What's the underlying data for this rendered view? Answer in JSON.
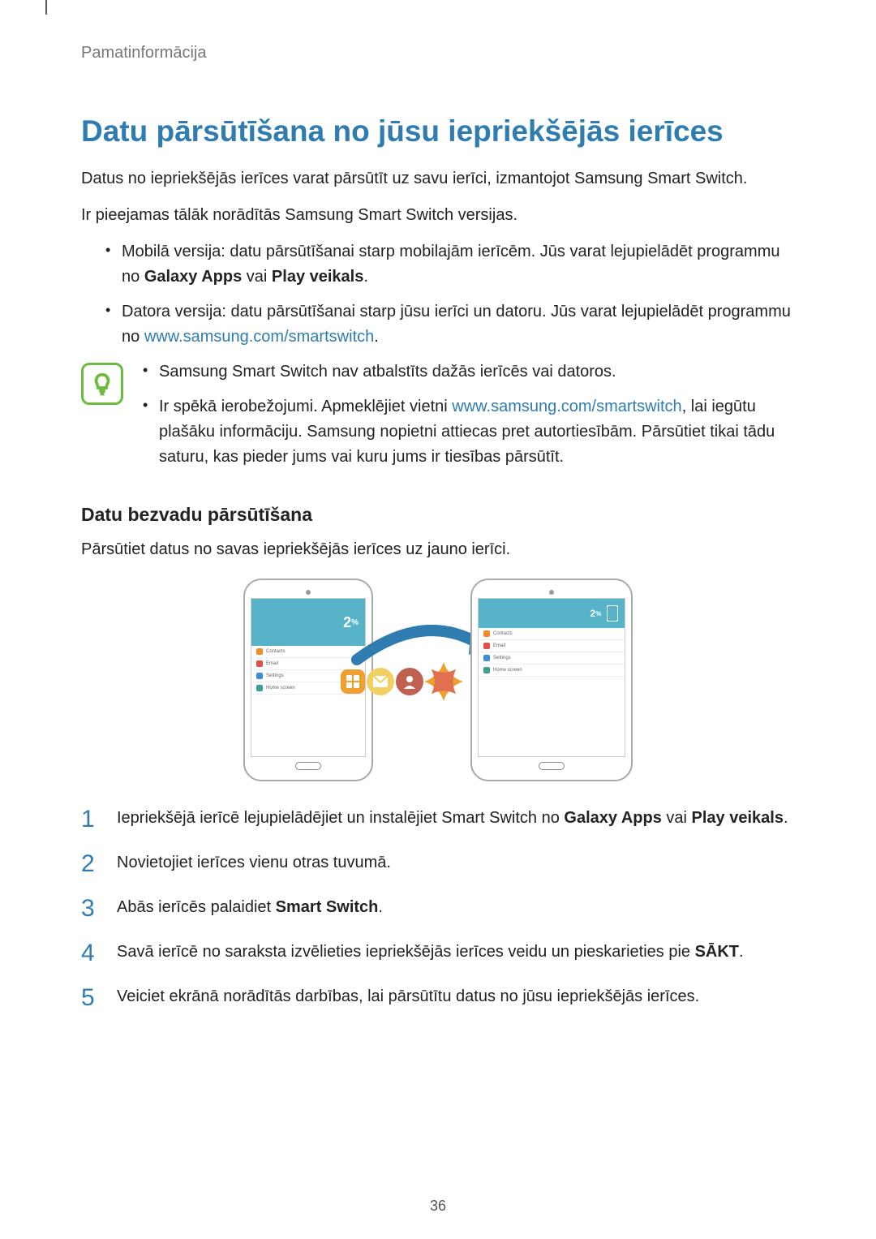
{
  "section_label": "Pamatinformācija",
  "title": "Datu pārsūtīšana no jūsu iepriekšējās ierīces",
  "intro1": "Datus no iepriekšējās ierīces varat pārsūtīt uz savu ierīci, izmantojot Samsung Smart Switch.",
  "intro2": "Ir pieejamas tālāk norādītās Samsung Smart Switch versijas.",
  "bullet1_pre": "Mobilā versija: datu pārsūtīšanai starp mobilajām ierīcēm. Jūs varat lejupielādēt programmu no ",
  "bullet1_b1": "Galaxy Apps",
  "bullet1_mid": " vai ",
  "bullet1_b2": "Play veikals",
  "bullet1_end": ".",
  "bullet2_pre": "Datora versija: datu pārsūtīšanai starp jūsu ierīci un datoru. Jūs varat lejupielādēt programmu no ",
  "bullet2_link": "www.samsung.com/smartswitch",
  "bullet2_end": ".",
  "note1": "Samsung Smart Switch nav atbalstīts dažās ierīcēs vai datoros.",
  "note2_pre": "Ir spēkā ierobežojumi. Apmeklējiet vietni ",
  "note2_link": "www.samsung.com/smartswitch",
  "note2_post": ", lai iegūtu plašāku informāciju. Samsung nopietni attiecas pret autortiesībām. Pārsūtiet tikai tādu saturu, kas pieder jums vai kuru jums ir tiesības pārsūtīt.",
  "subheading": "Datu bezvadu pārsūtīšana",
  "sub_intro": "Pārsūtiet datus no savas iepriekšējās ierīces uz jauno ierīci.",
  "step1_pre": "Iepriekšējā ierīcē lejupielādējiet un instalējiet Smart Switch no ",
  "step1_b1": "Galaxy Apps",
  "step1_mid": " vai ",
  "step1_b2": "Play veikals",
  "step1_end": ".",
  "step2": "Novietojiet ierīces vienu otras tuvumā.",
  "step3_pre": "Abās ierīcēs palaidiet ",
  "step3_b": "Smart Switch",
  "step3_end": ".",
  "step4_pre": "Savā ierīcē no saraksta izvēlieties iepriekšējās ierīces veidu un pieskarieties pie ",
  "step4_b": "SĀKT",
  "step4_end": ".",
  "step5": "Veiciet ekrānā norādītās darbības, lai pārsūtītu datus no jūsu iepriekšējās ierīces.",
  "page_number": "36",
  "illustration": {
    "phone_percent": "2",
    "tablet_percent": "2",
    "rows": [
      {
        "color": "orange",
        "label": "Contacts"
      },
      {
        "color": "red",
        "label": "Email"
      },
      {
        "color": "blue",
        "label": "Settings"
      },
      {
        "color": "teal",
        "label": "Home screen"
      }
    ]
  }
}
